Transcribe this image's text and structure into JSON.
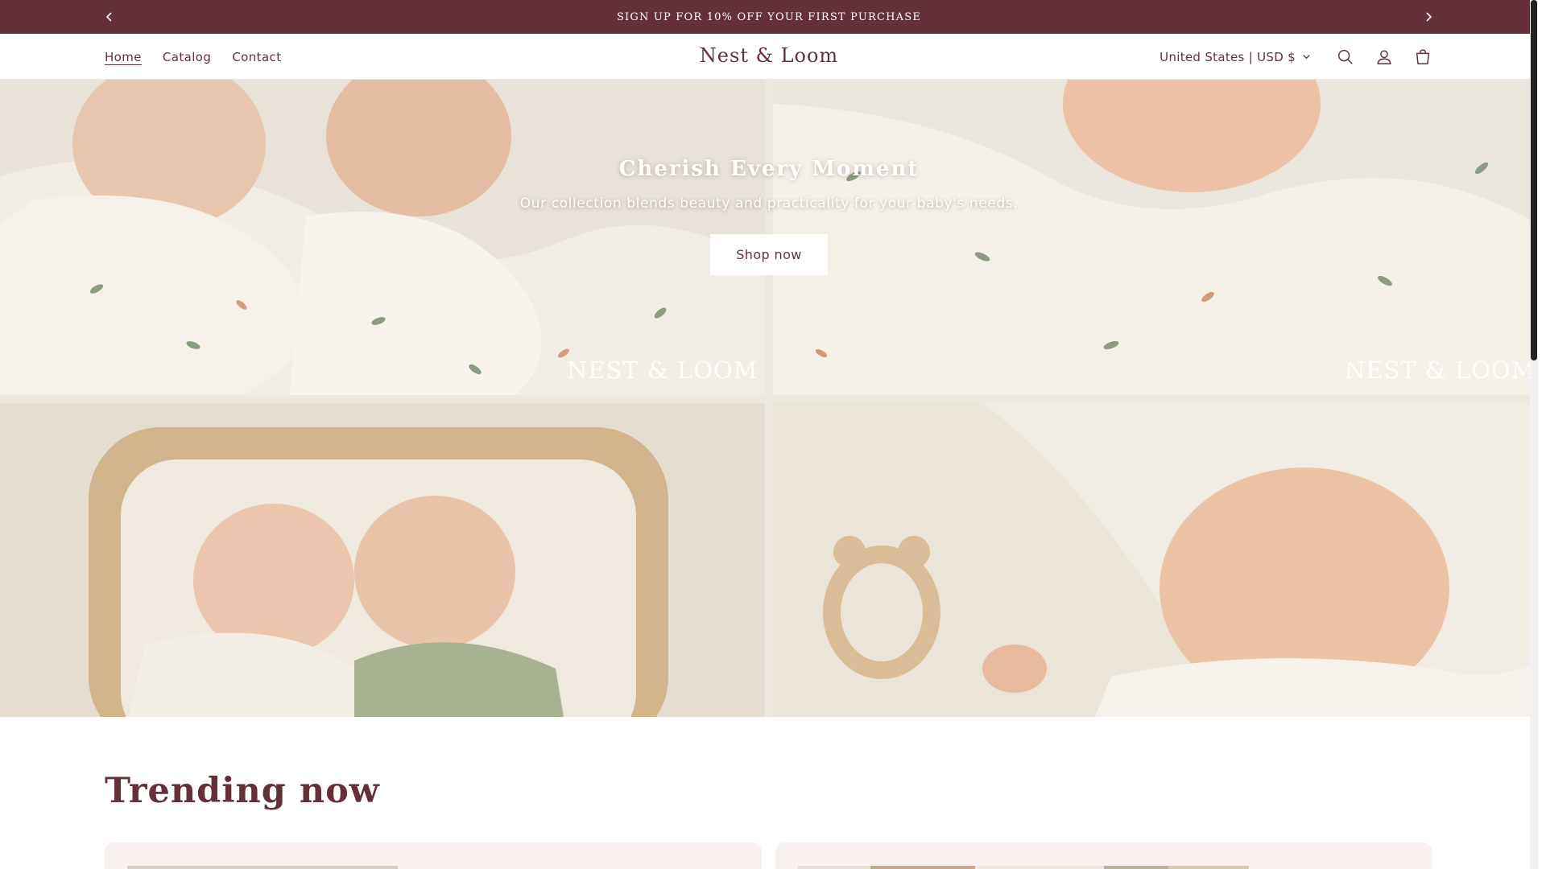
{
  "announcement": {
    "message": "SIGN UP FOR 10% OFF YOUR FIRST PURCHASE",
    "prev_icon": "chevron-left-icon",
    "next_icon": "chevron-right-icon",
    "bg_color": "#64313b"
  },
  "header": {
    "nav": [
      {
        "label": "Home",
        "active": true
      },
      {
        "label": "Catalog",
        "active": false
      },
      {
        "label": "Contact",
        "active": false
      }
    ],
    "logo": "Nest & Loom",
    "currency": "United States | USD $",
    "icons": [
      "search-icon",
      "account-icon",
      "cart-icon"
    ],
    "accent_color": "#64313b"
  },
  "hero": {
    "title": "Cherish Every Moment",
    "subtitle": "Our collection blends beauty and practicality for your baby's needs.",
    "button_label": "Shop now",
    "watermarks": [
      "NEST & LOOM",
      "NEST & LOOM"
    ]
  },
  "trending": {
    "title": "Trending now"
  }
}
